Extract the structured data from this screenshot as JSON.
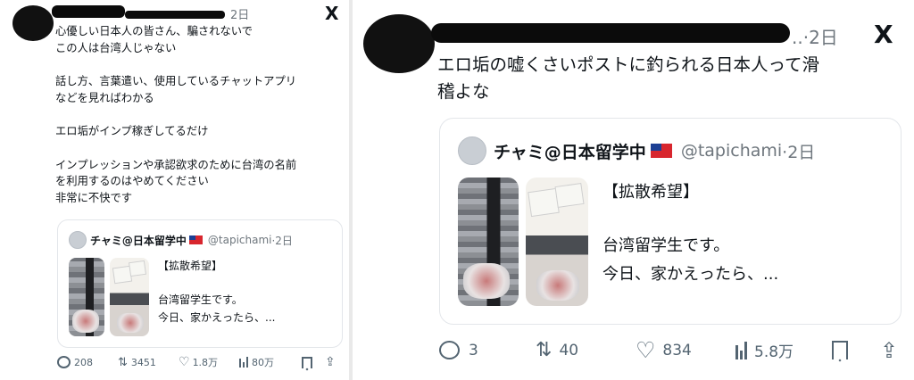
{
  "left": {
    "meta_time": "2日",
    "x_logo": "X",
    "post_text": "心優しい日本人の皆さん、騙されないで\nこの人は台湾人じゃない\n\n話し方、言葉遣い、使用しているチャットアプリ\nなどを見ればわかる\n\nエロ垢がインプ稼ぎしてるだけ\n\nインプレッションや承認欲求のために台湾の名前\nを利用するのはやめてください\n非常に不快です",
    "quote": {
      "name": "チャミ@日本留学中",
      "handle": "@tapichami",
      "time": "·2日",
      "line1": "【拡散希望】",
      "line2": "台湾留学生です。",
      "line3": "今日、家かえったら、..."
    },
    "actions": {
      "replies": "208",
      "reposts": "3451",
      "likes": "1.8万",
      "views": "80万"
    }
  },
  "right": {
    "meta_time": "..·2日",
    "x_logo": "X",
    "post_text": "エロ垢の嘘くさいポストに釣られる日本人って滑\n稽よな",
    "quote": {
      "name": "チャミ@日本留学中",
      "handle": "@tapichami",
      "time": "·2日",
      "line1": "【拡散希望】",
      "line2": "台湾留学生です。",
      "line3": "今日、家かえったら、..."
    },
    "actions": {
      "replies": "3",
      "reposts": "40",
      "likes": "834",
      "views": "5.8万"
    }
  },
  "icons": {
    "reply": "reply-icon",
    "repost": "repost-icon",
    "like": "heart-icon",
    "views": "views-icon",
    "bookmark": "bookmark-icon",
    "share": "share-icon"
  },
  "colors": {
    "text": "#0f1419",
    "muted": "#536471",
    "border": "#e3e6ea",
    "redaction": "#0b0b0b"
  }
}
